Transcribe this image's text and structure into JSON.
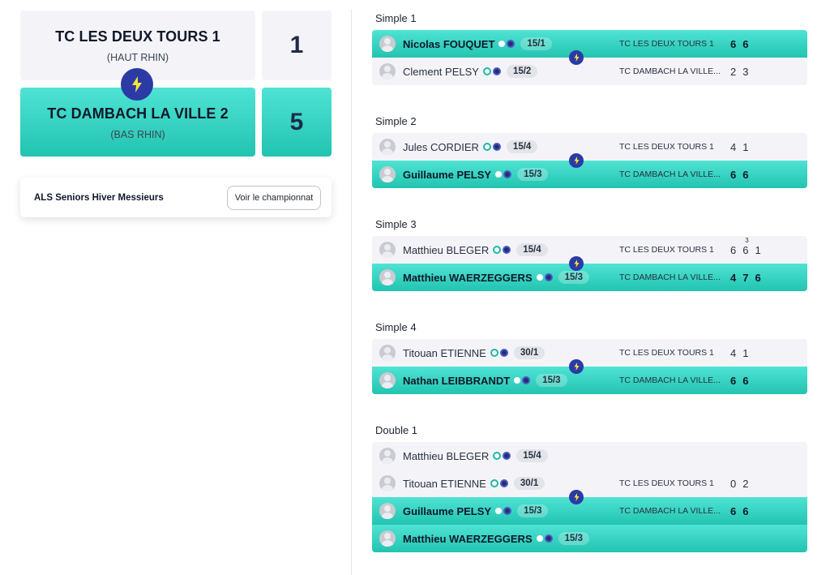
{
  "home_team": {
    "name": "TC LES DEUX TOURS 1",
    "region": "(HAUT RHIN)",
    "score": "1"
  },
  "away_team": {
    "name": "TC DAMBACH LA VILLE 2",
    "region": "(BAS RHIN)",
    "score": "5"
  },
  "championship": {
    "title": "ALS Seniors Hiver Messieurs",
    "button_label": "Voir le championnat"
  },
  "colors": {
    "accent_teal": "#2ad0bd",
    "bolt_blue": "#2c3aa6",
    "light_bg": "#f4f4f8"
  },
  "icons": {
    "versus": "lightning-bolt-icon",
    "player": "avatar-icon"
  },
  "matches": [
    {
      "title": "Simple 1",
      "rows": [
        {
          "player": "Nicolas FOUQUET",
          "rank": "15/1",
          "club": "TC LES DEUX TOURS 1",
          "scores": [
            "6",
            "6"
          ],
          "winner": true
        },
        {
          "player": "Clement PELSY",
          "rank": "15/2",
          "club": "TC DAMBACH LA VILLE...",
          "scores": [
            "2",
            "3"
          ],
          "winner": false
        }
      ]
    },
    {
      "title": "Simple 2",
      "rows": [
        {
          "player": "Jules CORDIER",
          "rank": "15/4",
          "club": "TC LES DEUX TOURS 1",
          "scores": [
            "4",
            "1"
          ],
          "winner": false
        },
        {
          "player": "Guillaume PELSY",
          "rank": "15/3",
          "club": "TC DAMBACH LA VILLE...",
          "scores": [
            "6",
            "6"
          ],
          "winner": true
        }
      ]
    },
    {
      "title": "Simple 3",
      "rows": [
        {
          "player": "Matthieu BLEGER",
          "rank": "15/4",
          "club": "TC LES DEUX TOURS 1",
          "scores": [
            "6",
            "6",
            "1"
          ],
          "tiebreak": "3",
          "winner": false
        },
        {
          "player": "Matthieu WAERZEGGERS",
          "rank": "15/3",
          "club": "TC DAMBACH LA VILLE...",
          "scores": [
            "4",
            "7",
            "6"
          ],
          "winner": true
        }
      ]
    },
    {
      "title": "Simple 4",
      "rows": [
        {
          "player": "Titouan ETIENNE",
          "rank": "30/1",
          "club": "TC LES DEUX TOURS 1",
          "scores": [
            "4",
            "1"
          ],
          "winner": false
        },
        {
          "player": "Nathan LEIBBRANDT",
          "rank": "15/3",
          "club": "TC DAMBACH LA VILLE...",
          "scores": [
            "6",
            "6"
          ],
          "winner": true
        }
      ]
    },
    {
      "title": "Double 1",
      "rows": [
        {
          "player": "Matthieu BLEGER",
          "rank": "15/4",
          "winner": false
        },
        {
          "player": "Titouan ETIENNE",
          "rank": "30/1",
          "club": "TC LES DEUX TOURS 1",
          "scores": [
            "0",
            "2"
          ],
          "winner": false
        },
        {
          "player": "Guillaume PELSY",
          "rank": "15/3",
          "club": "TC DAMBACH LA VILLE...",
          "scores": [
            "6",
            "6"
          ],
          "winner": true
        },
        {
          "player": "Matthieu WAERZEGGERS",
          "rank": "15/3",
          "winner": true
        }
      ]
    }
  ]
}
